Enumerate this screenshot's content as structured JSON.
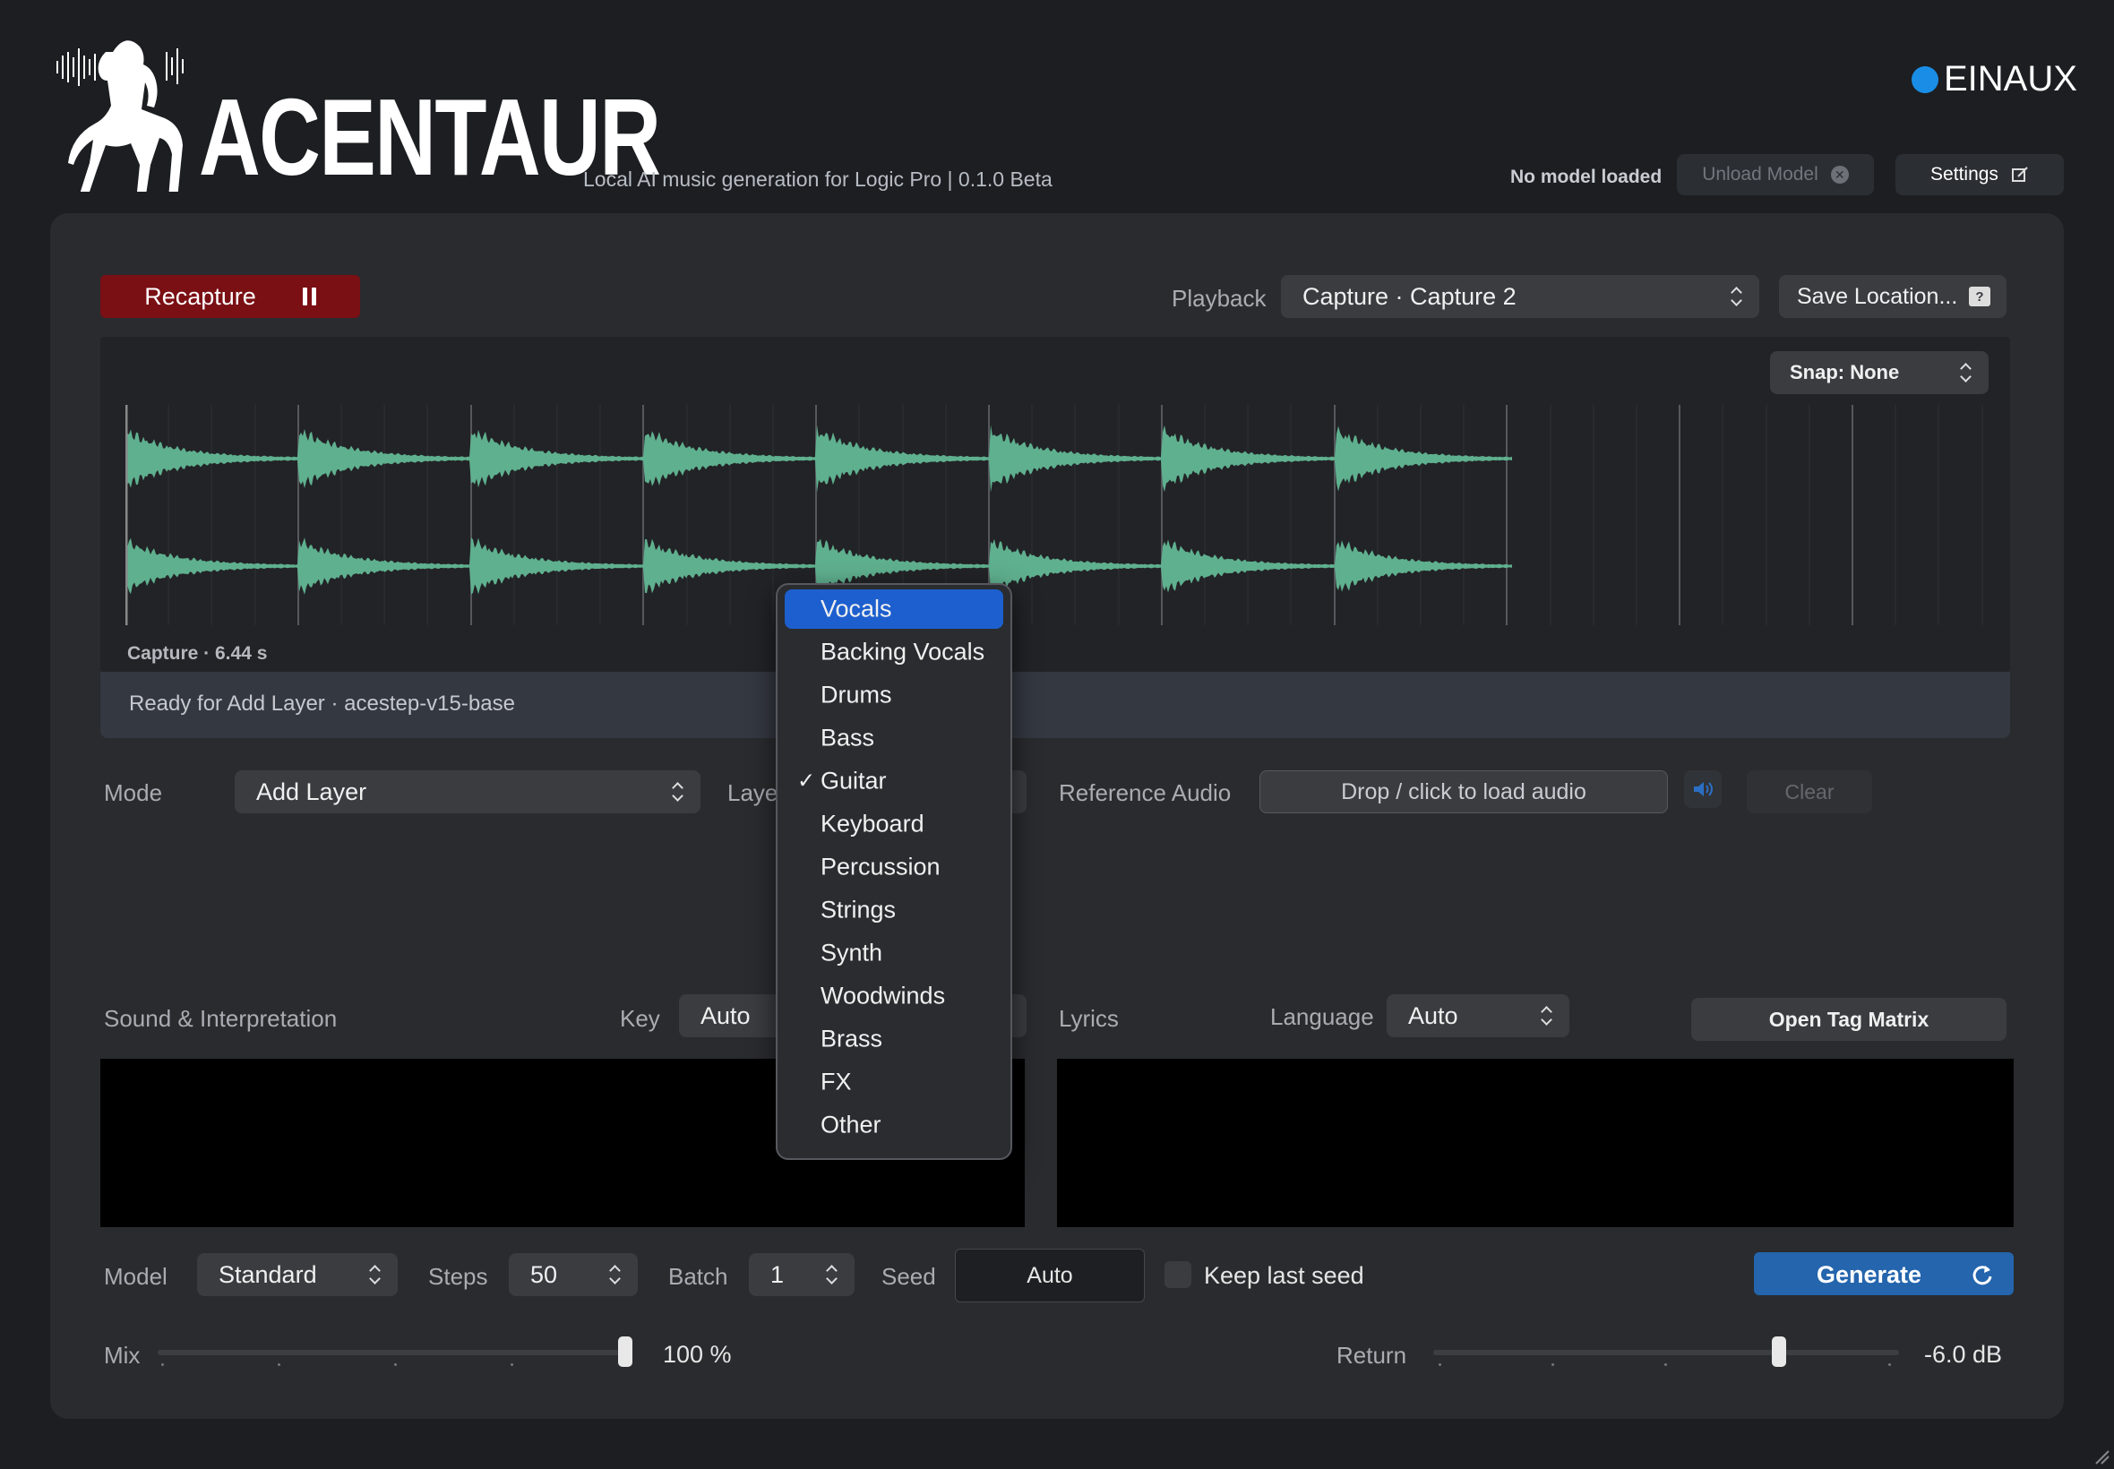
{
  "header": {
    "app_name": "ACENTAUR",
    "tagline": "Local AI music generation for Logic Pro | 0.1.0 Beta",
    "brand": "EINAUX",
    "model_status": "No model loaded",
    "unload_label": "Unload Model",
    "settings_label": "Settings"
  },
  "transport": {
    "recapture_label": "Recapture",
    "playback_label": "Playback",
    "playback_value": "Capture · Capture 2",
    "save_location_label": "Save Location...",
    "save_badge": "?"
  },
  "waveform": {
    "snap_label": "Snap: None",
    "capture_info": "Capture · 6.44 s",
    "status": "Ready for Add Layer · acestep-v15-base"
  },
  "mode": {
    "label": "Mode",
    "value": "Add Layer",
    "layer_label": "Layer",
    "reference_label": "Reference Audio",
    "drop_label": "Drop / click to load audio",
    "clear_label": "Clear"
  },
  "sound": {
    "label": "Sound & Interpretation",
    "key_label": "Key",
    "key_value": "Auto"
  },
  "lyrics": {
    "label": "Lyrics",
    "language_label": "Language",
    "language_value": "Auto",
    "tag_matrix_label": "Open Tag Matrix"
  },
  "generation": {
    "model_label": "Model",
    "model_value": "Standard",
    "steps_label": "Steps",
    "steps_value": "50",
    "batch_label": "Batch",
    "batch_value": "1",
    "seed_label": "Seed",
    "seed_value": "Auto",
    "keep_seed_label": "Keep last seed",
    "generate_label": "Generate"
  },
  "mix": {
    "mix_label": "Mix",
    "mix_value": "100 %",
    "mix_level": 1.0,
    "return_label": "Return",
    "return_value": "-6.0 dB",
    "return_level": 0.75
  },
  "layer_menu": {
    "items": [
      "Vocals",
      "Backing Vocals",
      "Drums",
      "Bass",
      "Guitar",
      "Keyboard",
      "Percussion",
      "Strings",
      "Synth",
      "Woodwinds",
      "Brass",
      "FX",
      "Other"
    ],
    "highlighted": "Vocals",
    "checked": "Guitar"
  },
  "colors": {
    "accent": "#2465ad",
    "recapture": "#7a0f14",
    "waveform": "#5fb08f",
    "menu_highlight": "#1d5fce",
    "brand_dot": "#1a8ee6"
  }
}
